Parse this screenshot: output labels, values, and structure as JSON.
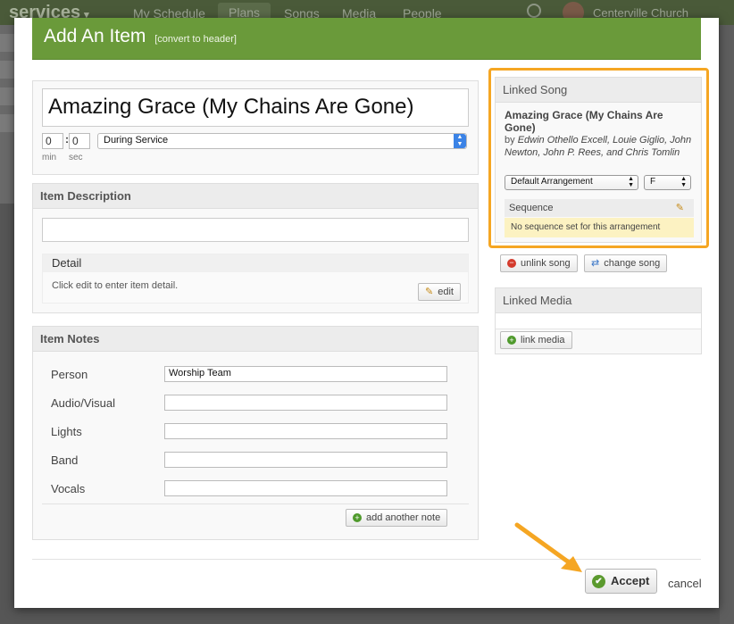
{
  "background": {
    "logo": "services",
    "nav": [
      "My Schedule",
      "Plans",
      "Songs",
      "Media",
      "People"
    ],
    "church": "Centerville Church"
  },
  "modal": {
    "title": "Add An Item",
    "title_action": "[convert to header]"
  },
  "item": {
    "title": "Amazing Grace (My Chains Are Gone)",
    "length_min": "0",
    "length_sec": "0",
    "min_label": "min",
    "sec_label": "sec",
    "timing": "During Service"
  },
  "description": {
    "header": "Item Description",
    "detail_header": "Detail",
    "detail_text": "Click edit to enter item detail.",
    "edit_label": "edit"
  },
  "notes": {
    "header": "Item Notes",
    "rows": [
      {
        "label": "Person",
        "value": "Worship Team"
      },
      {
        "label": "Audio/Visual",
        "value": ""
      },
      {
        "label": "Lights",
        "value": ""
      },
      {
        "label": "Band",
        "value": ""
      },
      {
        "label": "Vocals",
        "value": ""
      }
    ],
    "add_label": "add another note"
  },
  "linked_song": {
    "header": "Linked Song",
    "title": "Amazing Grace (My Chains Are Gone)",
    "by_prefix": "by",
    "authors": "Edwin Othello Excell, Louie Giglio, John Newton, John P. Rees, and Chris Tomlin",
    "arrangement": "Default Arrangement",
    "key": "F",
    "sequence_label": "Sequence",
    "sequence_note": "No sequence set for this arrangement",
    "unlink_label": "unlink song",
    "change_label": "change song"
  },
  "linked_media": {
    "header": "Linked Media",
    "link_label": "link media"
  },
  "footer": {
    "accept_label": "Accept",
    "cancel_label": "cancel"
  },
  "colors": {
    "header_green": "#6a9a3a",
    "highlight_orange": "#f5a623",
    "sequence_note_bg": "#fcf2c2"
  }
}
